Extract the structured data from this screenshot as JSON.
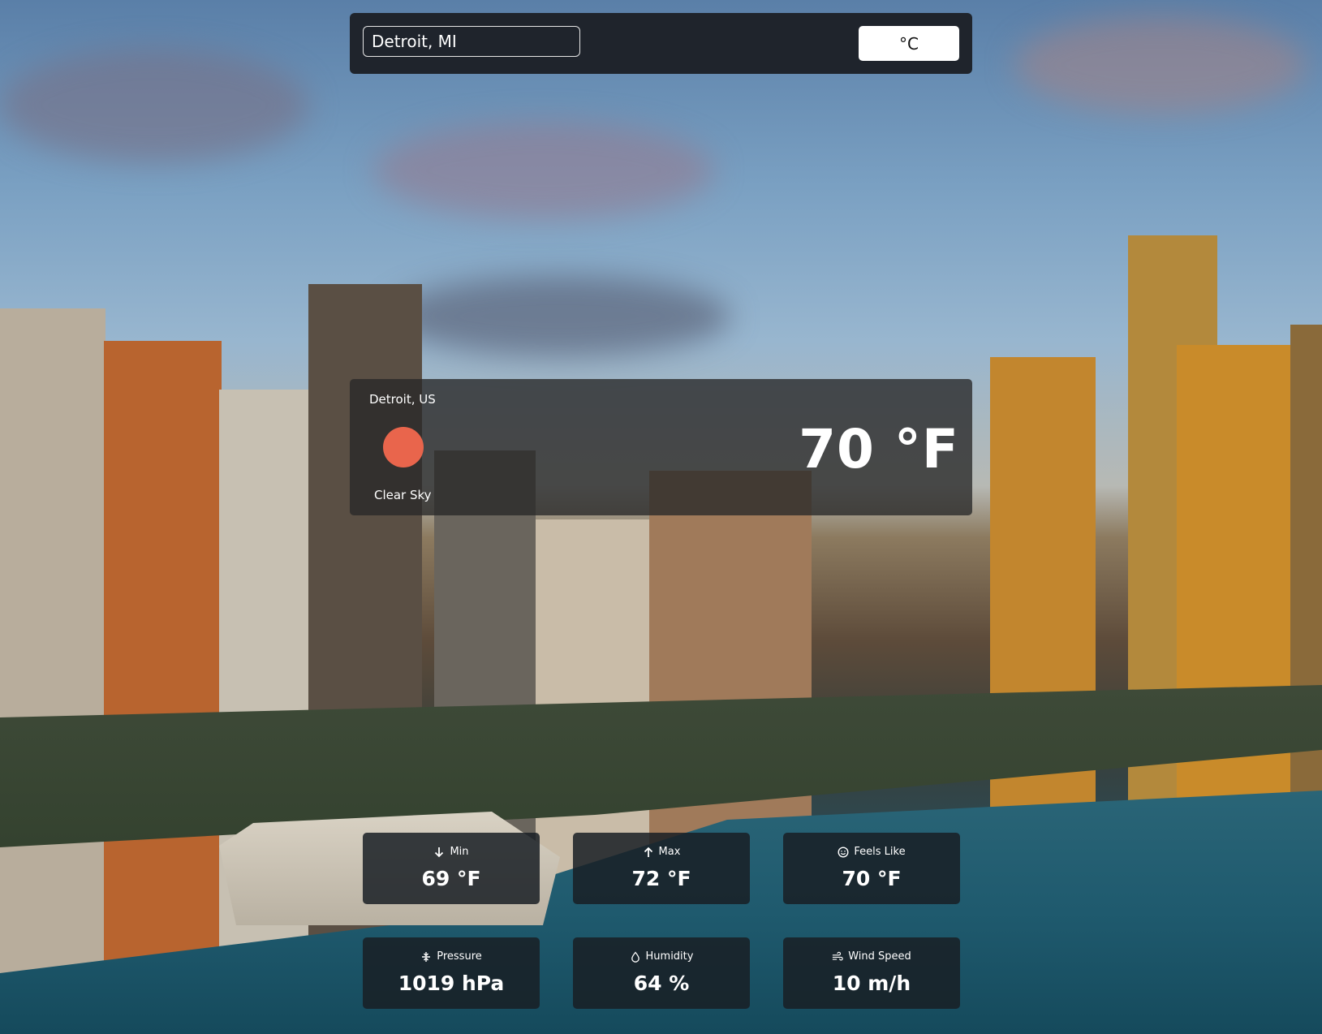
{
  "search": {
    "value": "Detroit, MI"
  },
  "unit_toggle": {
    "label": "°C"
  },
  "current": {
    "location": "Detroit, US",
    "condition": "Clear Sky",
    "temperature": "70 °F",
    "icon": "sun-icon",
    "icon_color": "#e9654c"
  },
  "stats": [
    {
      "label": "Min",
      "value": "69 °F",
      "icon": "arrow-down-icon"
    },
    {
      "label": "Max",
      "value": "72 °F",
      "icon": "arrow-up-icon"
    },
    {
      "label": "Feels Like",
      "value": "70 °F",
      "icon": "smiley-icon"
    },
    {
      "label": "Pressure",
      "value": "1019 hPa",
      "icon": "pressure-icon"
    },
    {
      "label": "Humidity",
      "value": "64 %",
      "icon": "droplet-icon"
    },
    {
      "label": "Wind Speed",
      "value": "10 m/h",
      "icon": "wind-icon"
    }
  ]
}
